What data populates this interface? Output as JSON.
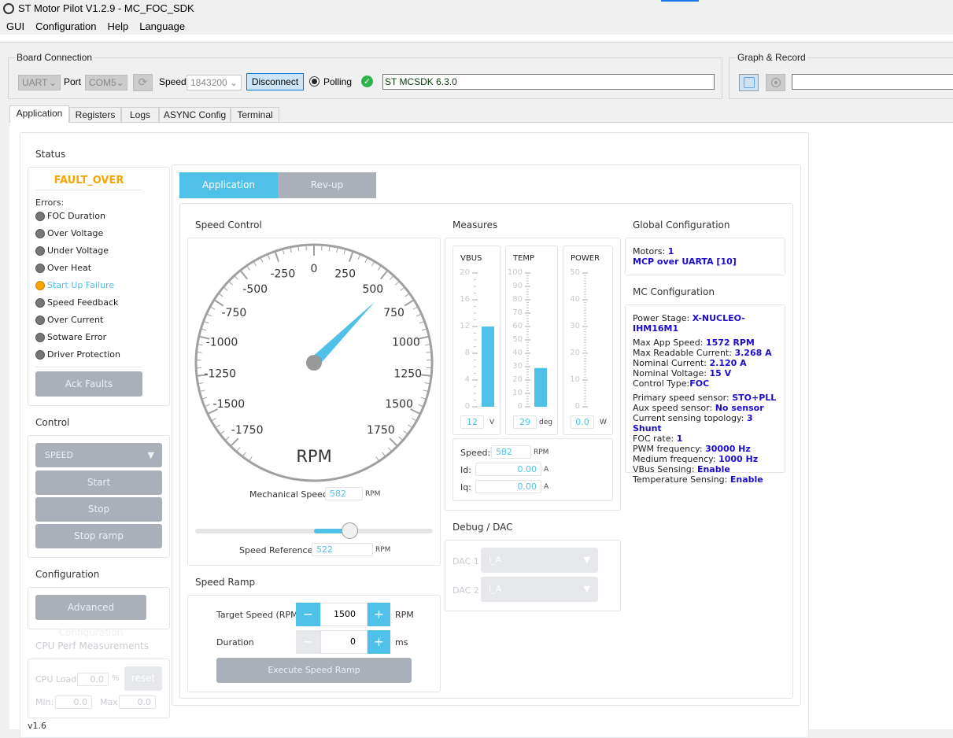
{
  "window": {
    "title": "ST Motor Pilot V1.2.9 - MC_FOC_SDK"
  },
  "menu": [
    "GUI",
    "Configuration",
    "Help",
    "Language"
  ],
  "board_connection": {
    "title": "Board Connection",
    "protocol": "UART",
    "port_label": "Port",
    "port": "COM5",
    "speed_label": "Speed",
    "speed": "1843200",
    "disconnect": "Disconnect",
    "polling": "Polling",
    "status": "ST MCSDK 6.3.0"
  },
  "graph_record": {
    "title": "Graph & Record",
    "value": ""
  },
  "tabs": [
    "Application",
    "Registers",
    "Logs",
    "ASYNC Config",
    "Terminal"
  ],
  "status": {
    "title": "Status",
    "state": "FAULT_OVER",
    "errors_label": "Errors:",
    "errors": [
      {
        "label": "FOC Duration",
        "active": false
      },
      {
        "label": "Over Voltage",
        "active": false
      },
      {
        "label": "Under Voltage",
        "active": false
      },
      {
        "label": "Over Heat",
        "active": false
      },
      {
        "label": "Start Up Failure",
        "active": true
      },
      {
        "label": "Speed Feedback",
        "active": false
      },
      {
        "label": "Over Current",
        "active": false
      },
      {
        "label": "Sotware Error",
        "active": false
      },
      {
        "label": "Driver Protection",
        "active": false
      }
    ],
    "ack": "Ack Faults"
  },
  "control": {
    "title": "Control",
    "mode": "SPEED",
    "start": "Start",
    "stop": "Stop",
    "stop_ramp": "Stop ramp"
  },
  "configuration": {
    "title": "Configuration",
    "advanced": "Advanced Configuration"
  },
  "cpu": {
    "title": "CPU Perf Measurements",
    "load_label": "CPU Load:",
    "load": "0.0",
    "pct": "%",
    "reset": "reset",
    "min_label": "Min:",
    "min": "0.0",
    "max_label": "Max:",
    "max": "0.0"
  },
  "version": "v1.6",
  "subtabs": [
    "Application",
    "Rev-up"
  ],
  "speed_control": {
    "title": "Speed Control",
    "gauge": {
      "min": -1750,
      "max": 1750,
      "step": 250,
      "unit": "RPM",
      "value": 582,
      "labels": [
        "-1750",
        "-1500",
        "-1250",
        "-1000",
        "-750",
        "-500",
        "-250",
        "0",
        "250",
        "500",
        "750",
        "1000",
        "1250",
        "1500",
        "1750"
      ]
    },
    "mech_label": "Mechanical Speed:",
    "mech": "582",
    "mech_unit": "RPM",
    "ref_label": "Speed Reference:",
    "ref": "522",
    "ref_unit": "RPM",
    "slider_value": 522
  },
  "speed_ramp": {
    "title": "Speed Ramp",
    "target_label": "Target Speed (RPM)",
    "target": "1500",
    "target_unit": "RPM",
    "duration_label": "Duration",
    "duration": "0",
    "duration_unit": "ms",
    "execute": "Execute Speed Ramp",
    "minus": "−",
    "plus": "+"
  },
  "measures": {
    "title": "Measures",
    "meters": [
      {
        "name": "VBUS",
        "max": 20,
        "major": 4,
        "value": 12,
        "display": "12",
        "unit": "V",
        "labels": [
          "20",
          "16",
          "12",
          "8",
          "4",
          "0"
        ]
      },
      {
        "name": "TEMP",
        "max": 100,
        "major": 10,
        "value": 29,
        "display": "29",
        "unit": "deg",
        "labels": [
          "100",
          "90",
          "80",
          "70",
          "60",
          "50",
          "40",
          "30",
          "20",
          "10",
          "0"
        ]
      },
      {
        "name": "POWER",
        "max": 50,
        "major": 10,
        "value": 0,
        "display": "0.0",
        "unit": "W",
        "labels": [
          "50",
          "40",
          "30",
          "20",
          "10",
          "0"
        ]
      }
    ],
    "speed_label": "Speed:",
    "speed": "582",
    "speed_unit": "RPM",
    "id_label": "Id:",
    "id": "0.00",
    "id_unit": "A",
    "iq_label": "Iq:",
    "iq": "0.00",
    "iq_unit": "A"
  },
  "debug": {
    "title": "Debug / DAC",
    "dac1_label": "DAC 1",
    "dac1": "I_A",
    "dac2_label": "DAC 2",
    "dac2": "I_A"
  },
  "global_config": {
    "title": "Global Configuration",
    "rows": [
      [
        "Motors: ",
        "1"
      ],
      [
        "",
        "MCP over UARTA [10]"
      ]
    ]
  },
  "mc_config": {
    "title": "MC Configuration",
    "groups": [
      [
        [
          "Power Stage: ",
          "X-NUCLEO-IHM16M1"
        ]
      ],
      [
        [
          "Max App Speed: ",
          "1572 RPM"
        ],
        [
          "Max Readable Current: ",
          "3.268 A"
        ],
        [
          "Nominal Current: ",
          "2.120 A"
        ],
        [
          "Nominal Voltage: ",
          "15 V"
        ],
        [
          "Control Type:",
          "FOC"
        ]
      ],
      [
        [
          "Primary speed sensor: ",
          "STO+PLL"
        ],
        [
          "Aux speed sensor: ",
          "No sensor"
        ],
        [
          "Current sensing topology: ",
          "3 Shunt"
        ],
        [
          "FOC rate: ",
          "1"
        ],
        [
          "PWM frequency: ",
          "30000 Hz"
        ],
        [
          "Medium frequency: ",
          "1000 Hz"
        ],
        [
          "VBus Sensing: ",
          "Enable"
        ],
        [
          "Temperature Sensing: ",
          "Enable"
        ]
      ]
    ]
  },
  "colors": {
    "accent": "#4fc1e9",
    "fault": "#f7a600",
    "button_gray": "#a9b0ba",
    "value_blue": "#1a0dcc"
  }
}
